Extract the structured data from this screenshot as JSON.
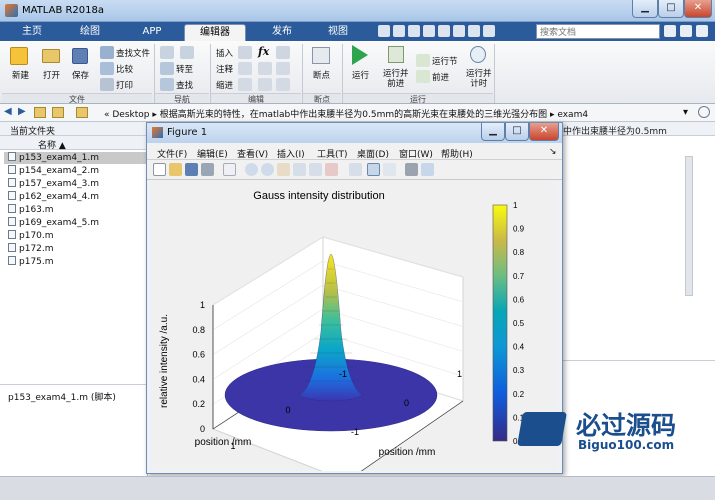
{
  "window": {
    "title": "MATLAB R2018a"
  },
  "tabs": [
    {
      "label": "主页"
    },
    {
      "label": "绘图"
    },
    {
      "label": "APP"
    },
    {
      "label": "编辑器"
    },
    {
      "label": "发布"
    },
    {
      "label": "视图"
    }
  ],
  "search": {
    "placeholder": "搜索文档"
  },
  "ribbon": {
    "new": "新建",
    "open": "打开",
    "save": "保存",
    "find_files": "查找文件",
    "compare": "比较",
    "print": "打印",
    "insert": "插入",
    "comment": "注释",
    "indent": "缩进",
    "goto": "转至",
    "find": "查找",
    "breakpoints": "断点",
    "run": "运行",
    "run_advance": "运行并\n前进",
    "run_section": "运行节",
    "advance": "前进",
    "run_time": "运行并\n计时",
    "groups": {
      "file": "文件",
      "navigate": "导航",
      "edit": "编辑",
      "breakpoints": "断点",
      "run": "运行"
    },
    "fx": "fx"
  },
  "address": {
    "path": "«  Desktop  ▸  根据高斯光束的特性，在matlab中作出束腰半径为0.5mm的高斯光束在束腰处的三维光强分布图  ▸  exam4",
    "overflow": "中作出束腰半径为0.5mm"
  },
  "left_panel": {
    "header": "当前文件夹",
    "column": "名称 ▲",
    "files": [
      "p153_exam4_1.m",
      "p154_exam4_2.m",
      "p157_exam4_3.m",
      "p162_exam4_4.m",
      "p163.m",
      "p169_exam4_5.m",
      "p170.m",
      "p172.m",
      "p175.m"
    ],
    "selected": "p153_exam4_1.m  (脚本)"
  },
  "figure": {
    "title": "Figure 1",
    "menu": [
      "文件(F)",
      "编辑(E)",
      "查看(V)",
      "插入(I)",
      "工具(T)",
      "桌面(D)",
      "窗口(W)",
      "帮助(H)"
    ]
  },
  "chart_data": {
    "type": "surface",
    "title": "Gauss intensity distribution",
    "xlabel": "position /mm",
    "ylabel": "position /mm",
    "zlabel": "relative intensity /a.u.",
    "x_ticks": [
      "-1",
      "0",
      "1"
    ],
    "y_ticks": [
      "-1",
      "0",
      "1"
    ],
    "z_ticks": [
      "0",
      "0.2",
      "0.4",
      "0.6",
      "0.8",
      "1"
    ],
    "colorbar_ticks": [
      "0",
      "0.1",
      "0.2",
      "0.3",
      "0.4",
      "0.5",
      "0.6",
      "0.7",
      "0.8",
      "0.9",
      "1"
    ],
    "xlim": [
      -1,
      1
    ],
    "ylim": [
      -1,
      1
    ],
    "zlim": [
      0,
      1
    ],
    "colormap": "parula",
    "peak": 1
  },
  "watermark": {
    "text": "必过源码",
    "sub": "Biguo100.com"
  },
  "colors": {
    "tab_bar": "#2b5b9a",
    "accent": "#1b4e8c"
  }
}
